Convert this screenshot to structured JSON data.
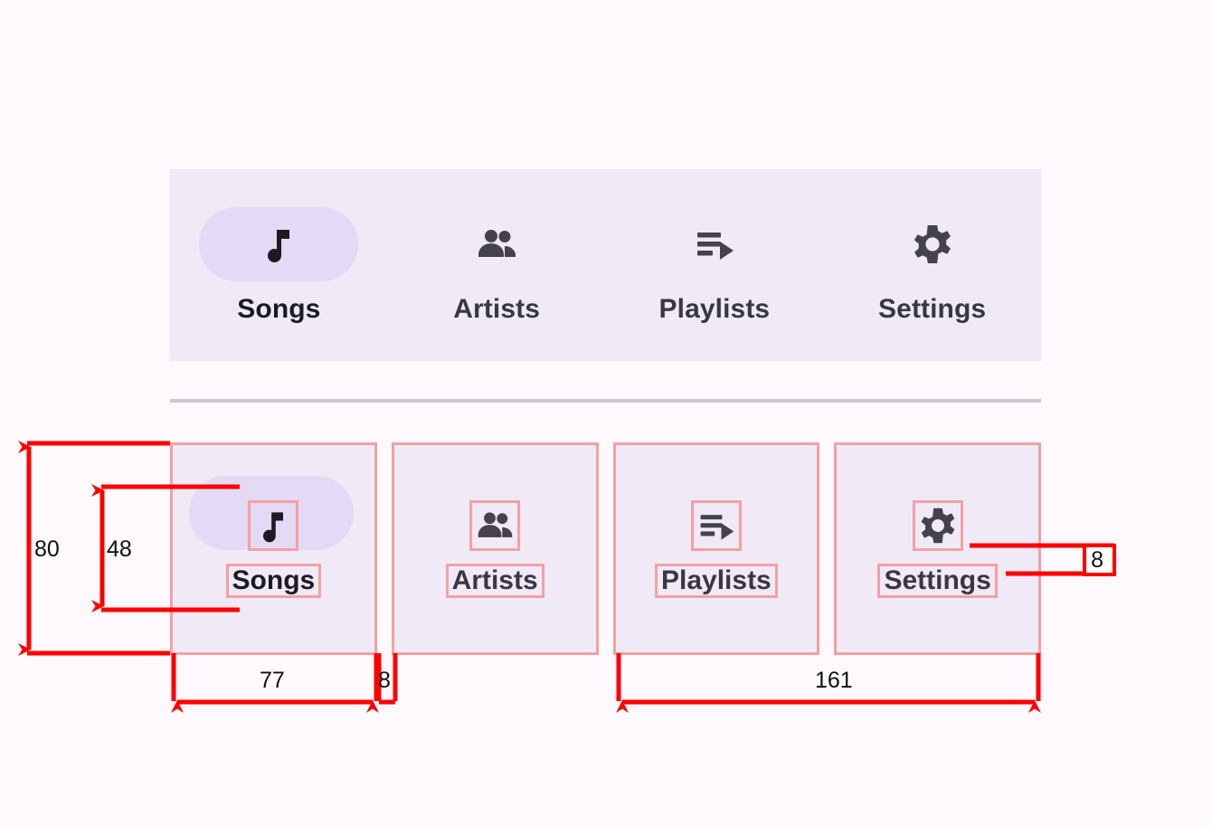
{
  "component": {
    "name": "Navigation Bar",
    "surface_color": "#EFEAF6",
    "active_indicator_color": "#E3DAF5",
    "icon_color": "#45424E",
    "label_color": "#3A3744",
    "page_background": "#FDF9FC",
    "divider_color": "#C9C6D4",
    "redline_color": "#FF0000",
    "spec_box_color": "#F4A0A3"
  },
  "nav": {
    "items": [
      {
        "id": "songs",
        "label": "Songs",
        "icon": "music-note-icon",
        "active": true
      },
      {
        "id": "artists",
        "label": "Artists",
        "icon": "people-group-icon",
        "active": false
      },
      {
        "id": "playlists",
        "label": "Playlists",
        "icon": "queue-music-icon",
        "active": false
      },
      {
        "id": "settings",
        "label": "Settings",
        "icon": "gear-icon",
        "active": false
      }
    ]
  },
  "spec": {
    "items": [
      {
        "id": "songs",
        "label": "Songs",
        "icon": "music-note-icon",
        "active": true
      },
      {
        "id": "artists",
        "label": "Artists",
        "icon": "people-group-icon",
        "active": false
      },
      {
        "id": "playlists",
        "label": "Playlists",
        "icon": "queue-music-icon",
        "active": false
      },
      {
        "id": "settings",
        "label": "Settings",
        "icon": "gear-icon",
        "active": false
      }
    ],
    "measurements": {
      "item_height": "80",
      "icon_size": "48",
      "label_width": "77",
      "item_gap": "8",
      "item_pair_width": "161",
      "icon_label_gap": "8"
    }
  }
}
